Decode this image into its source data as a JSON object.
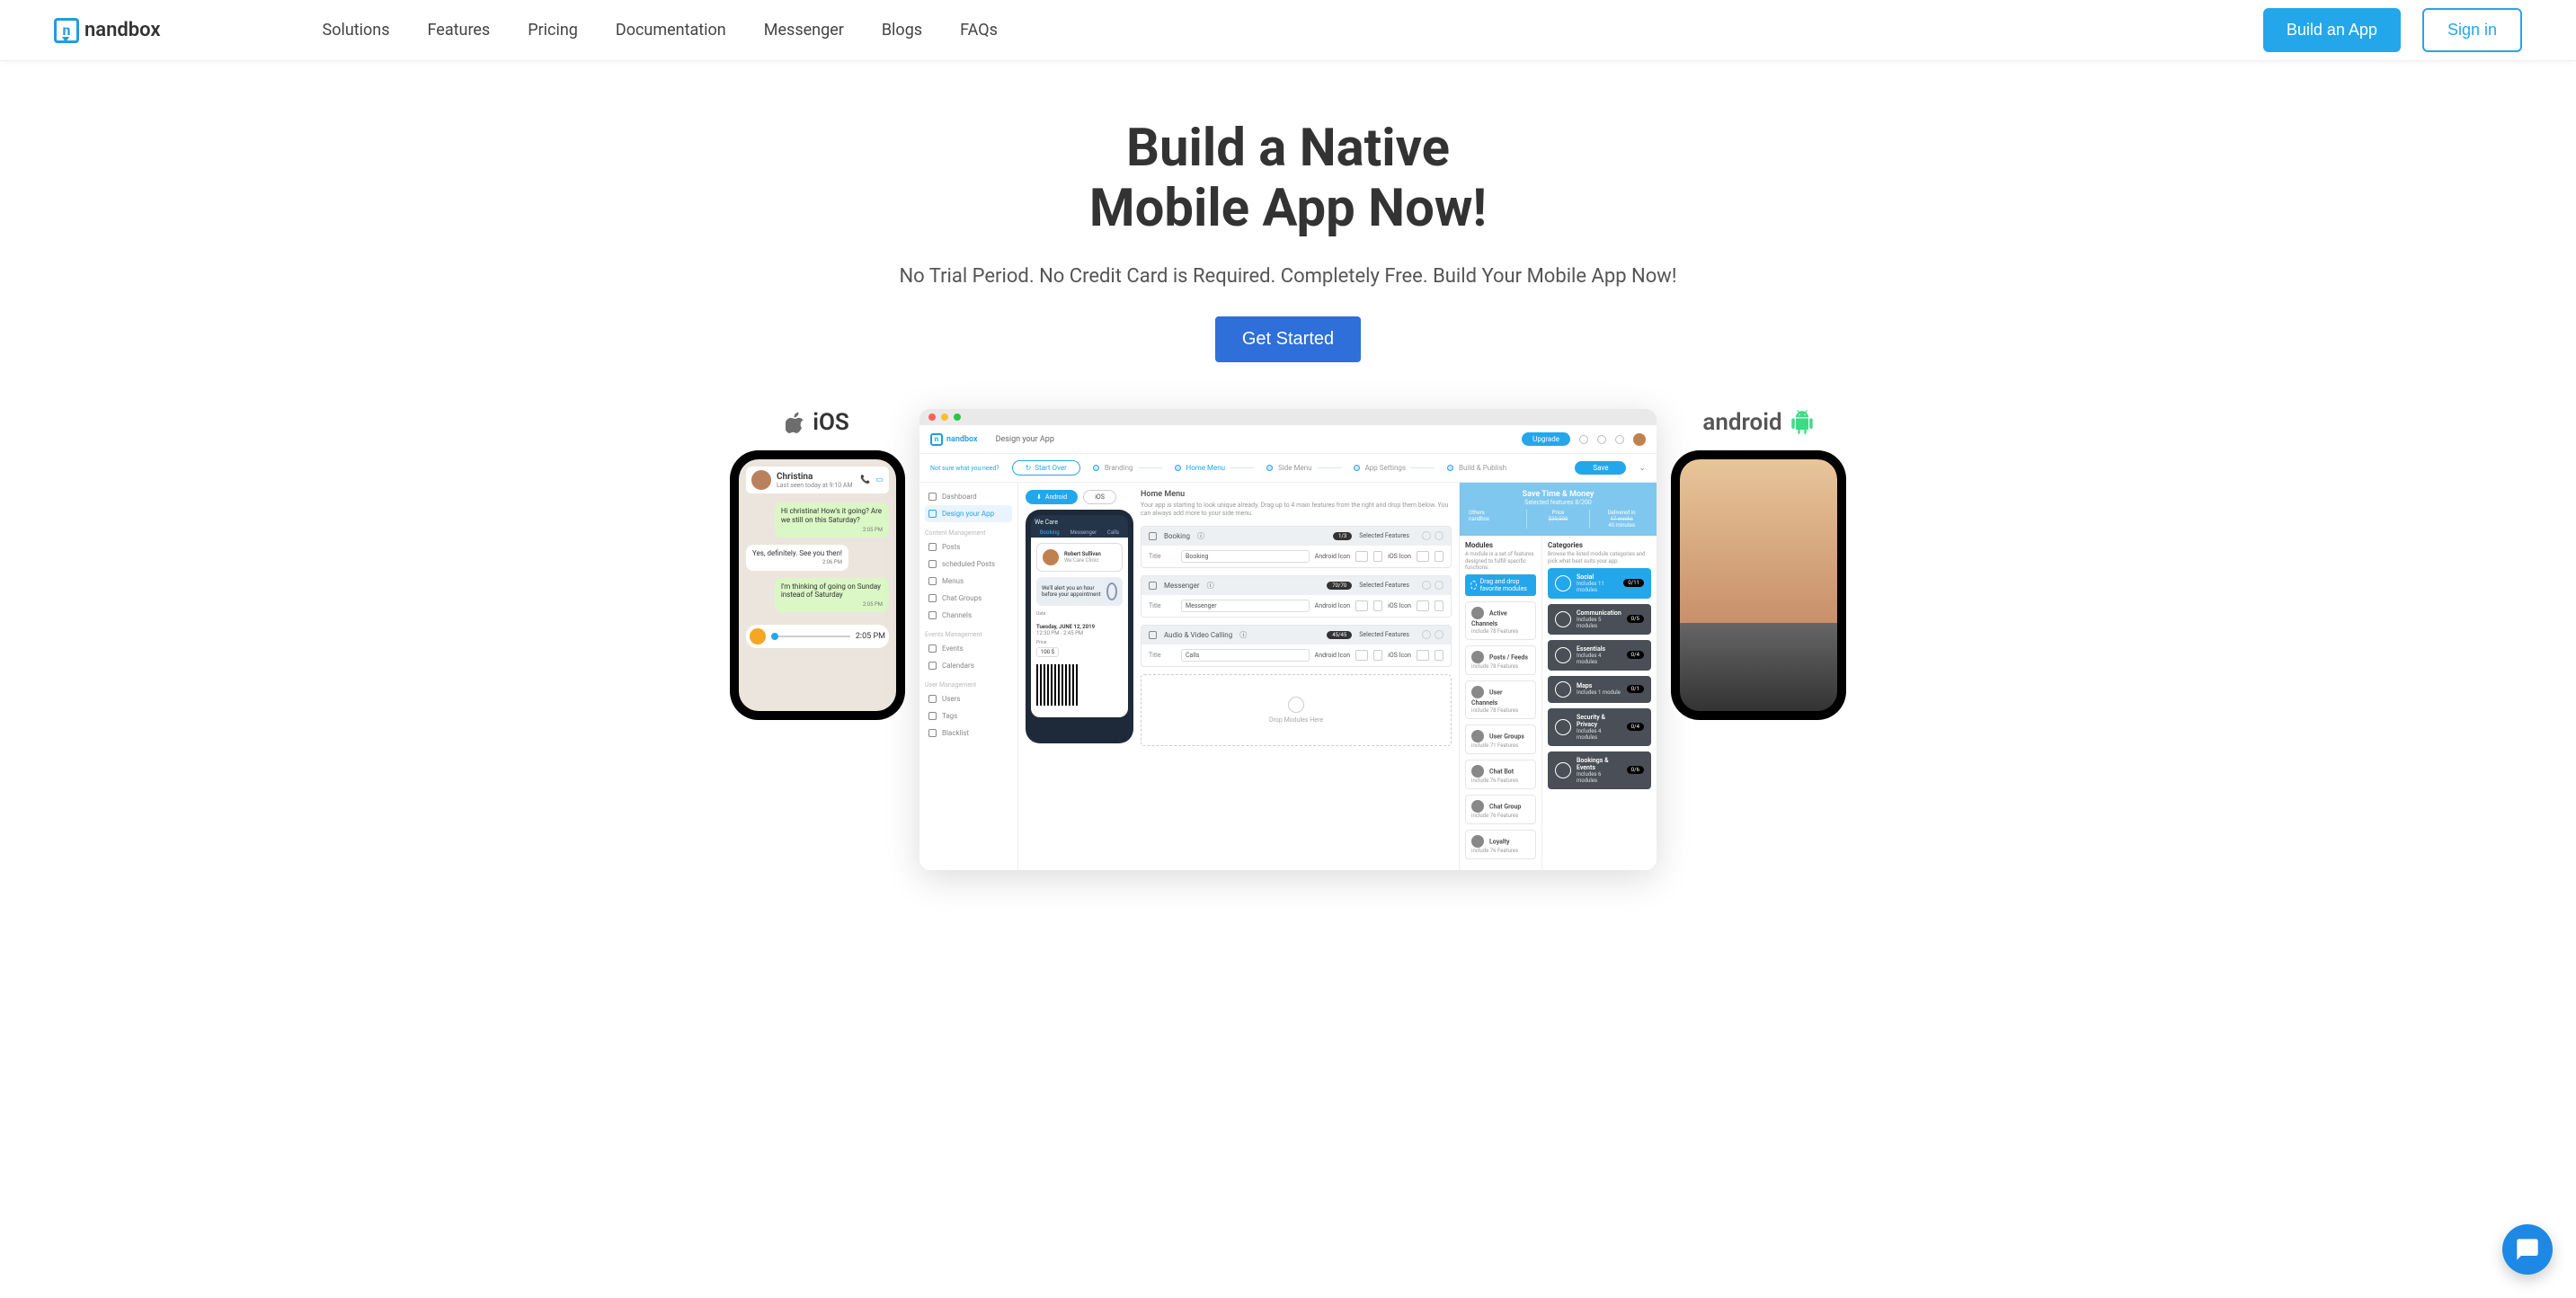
{
  "brand": "nandbox",
  "nav": {
    "items": [
      "Solutions",
      "Features",
      "Pricing",
      "Documentation",
      "Messenger",
      "Blogs",
      "FAQs"
    ],
    "build": "Build an App",
    "signin": "Sign in"
  },
  "hero": {
    "line1": "Build a Native",
    "line2": "Mobile App Now!",
    "subtitle": "No Trial Period. No Credit Card is Required. Completely Free. Build Your Mobile App Now!",
    "cta": "Get Started"
  },
  "os": {
    "ios": "iOS",
    "android": "android"
  },
  "chat_preview": {
    "name": "Christina",
    "last_seen": "Last seen today at 9:10 AM",
    "msgs": [
      {
        "dir": "out",
        "text": "Hi christina! How's it going? Are we still on this Saturday?",
        "time": "2:05 PM"
      },
      {
        "dir": "in",
        "text": "Yes, definitely. See you then!",
        "time": "2:06 PM"
      },
      {
        "dir": "out",
        "text": "I'm thinking of going on Sunday instead of Saturday",
        "time": "2:05 PM"
      }
    ],
    "voice_time": "2:05 PM"
  },
  "builder": {
    "header_title": "Design your App",
    "upgrade": "Upgrade",
    "start_over": "Start Over",
    "steps": [
      "Branding",
      "Home Menu",
      "Side Menu",
      "App Settings",
      "Build & Publish"
    ],
    "active_step_index": 1,
    "save": "Save",
    "rail": {
      "note": "Not sure what you need?",
      "top": [
        "Dashboard",
        "Design your App"
      ],
      "sections": [
        {
          "title": "Content Management",
          "items": [
            "Posts",
            "scheduled Posts",
            "Menus",
            "Chat Groups",
            "Channels"
          ]
        },
        {
          "title": "Events Management",
          "items": [
            "Events",
            "Calendars"
          ]
        },
        {
          "title": "User Management",
          "items": [
            "Users",
            "Tags",
            "Blacklist"
          ]
        }
      ]
    },
    "preview": {
      "android": "Android",
      "ios": "iOS",
      "app_name": "We Care",
      "tabs": [
        "Booking",
        "Messenger",
        "Calls"
      ],
      "card_name": "Robert Sullivan",
      "card_sub": "We Care Clinic",
      "alert": "We'll alert you an hour before your appointment",
      "date": "Tuesday, JUNE 12, 2019",
      "time": "12:30 PM - 2:45 PM",
      "price_label": "Price",
      "price": "100 $"
    },
    "config": {
      "title": "Home Menu",
      "subtitle": "Your app is starting to look unique already. Drag up to 4 main features from the right and drop them below. You can always add more to your side menu.",
      "selected": "Selected Features",
      "items": [
        {
          "name": "Booking",
          "badge": "1/3",
          "title_field": "Booking",
          "android_icon": "Android Icon",
          "ios_icon": "iOS Icon"
        },
        {
          "name": "Messenger",
          "badge": "70/70",
          "title_field": "Messenger",
          "android_icon": "Android Icon",
          "ios_icon": "iOS Icon"
        },
        {
          "name": "Audio & Video Calling",
          "badge": "45/45",
          "title_field": "Calls",
          "android_icon": "Android Icon",
          "ios_icon": "iOS Icon"
        }
      ],
      "title_label": "Title",
      "dropzone": "Drop Modules Here"
    },
    "right": {
      "banner": {
        "title": "Save Time & Money",
        "selected": "Selected features 8/200",
        "price_label": "Price",
        "others": "Others",
        "others_price": "$29,500",
        "nandbox": "nandbox",
        "delivered": "Delivered in",
        "weeks": "17 weeks",
        "minutes": "40 minutes"
      },
      "modules": {
        "title": "Modules",
        "sub": "A module is a set of features designed to fulfill specific functions.",
        "drag": "Drag and drop favorite modules",
        "list": [
          {
            "name": "Active Channels",
            "feat": "include 78 Features"
          },
          {
            "name": "Posts / Feeds",
            "feat": "include 78 Features"
          },
          {
            "name": "User Channels",
            "feat": "include 78 Features"
          },
          {
            "name": "User Groups",
            "feat": "include 71 Features"
          },
          {
            "name": "Chat Bot",
            "feat": "include 76 Features"
          },
          {
            "name": "Chat Group",
            "feat": "include 76 Features"
          },
          {
            "name": "Loyalty",
            "feat": "include 76 Features"
          }
        ]
      },
      "categories": {
        "title": "Categories",
        "sub": "Browse the listed module categories and pick what best suits your app.",
        "list": [
          {
            "name": "Social",
            "feat": "Includes 11 modules",
            "badge": "0/11"
          },
          {
            "name": "Communication",
            "feat": "Includes 5 modules",
            "badge": "0/5"
          },
          {
            "name": "Essentials",
            "feat": "Includes 4 modules",
            "badge": "0/4"
          },
          {
            "name": "Maps",
            "feat": "Includes 1 module",
            "badge": "0/1"
          },
          {
            "name": "Security & Privacy",
            "feat": "Includes 4 modules",
            "badge": "0/4"
          },
          {
            "name": "Bookings & Events",
            "feat": "Includes 6 modules",
            "badge": "0/6"
          }
        ]
      }
    }
  }
}
